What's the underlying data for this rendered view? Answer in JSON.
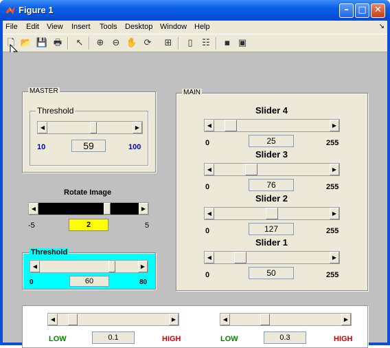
{
  "window": {
    "title": "Figure 1"
  },
  "menu": [
    "File",
    "Edit",
    "View",
    "Insert",
    "Tools",
    "Desktop",
    "Window",
    "Help"
  ],
  "toolbar_icons": [
    "new-file-icon",
    "open-icon",
    "save-icon",
    "print-icon",
    "pointer-icon",
    "zoom-in-icon",
    "zoom-out-icon",
    "pan-hand-icon",
    "rotate-3d-icon",
    "data-cursor-icon",
    "colorbar-icon",
    "legend-icon",
    "hide-plot-tools-icon",
    "show-plot-tools-icon"
  ],
  "master": {
    "title": "MASTER",
    "threshold_label": "Threshold",
    "value": "59",
    "min": "10",
    "max": "100",
    "level": 0.54
  },
  "rotate": {
    "title": "Rotate Image",
    "value": "2",
    "min": "-5",
    "max": "5",
    "level": 0.7
  },
  "threshold": {
    "title": "Threshold",
    "value": "60",
    "min": "0",
    "max": "80",
    "level": 0.75
  },
  "main": {
    "title": "MAIN",
    "sliders": [
      {
        "name": "Slider 4",
        "value": "25",
        "min": "0",
        "max": "255",
        "level": 0.098
      },
      {
        "name": "Slider 3",
        "value": "76",
        "min": "0",
        "max": "255",
        "level": 0.298
      },
      {
        "name": "Slider 2",
        "value": "127",
        "min": "0",
        "max": "255",
        "level": 0.498
      },
      {
        "name": "Slider 1",
        "value": "50",
        "min": "0",
        "max": "255",
        "level": 0.196
      }
    ]
  },
  "bottom": {
    "left": {
      "low": "LOW",
      "high": "HIGH",
      "value": "0.1",
      "level": 0.1
    },
    "right": {
      "low": "LOW",
      "high": "HIGH",
      "value": "0.3",
      "level": 0.3
    }
  },
  "colors": {
    "cyan_panel": "#00ffff",
    "yellow_box": "#ffff00",
    "blue_label": "#0000c8",
    "green_label": "#008000",
    "red_label": "#d00000"
  }
}
